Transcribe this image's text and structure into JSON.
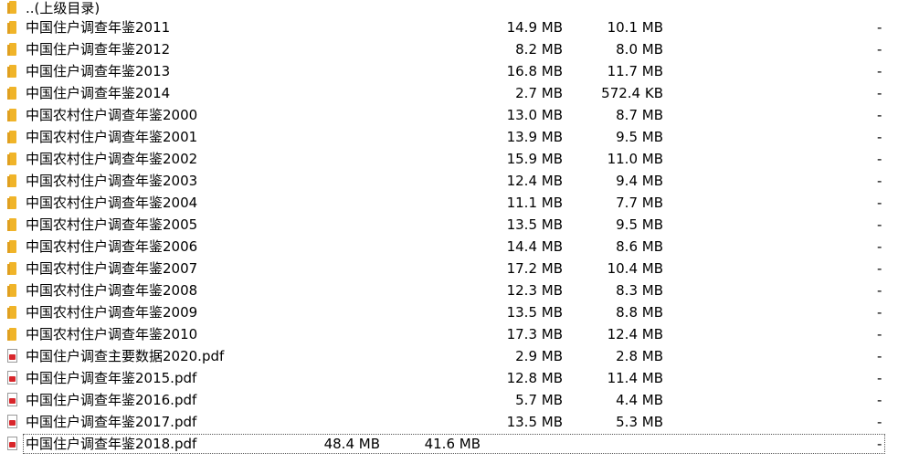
{
  "parent": {
    "name": "..(上级目录)",
    "icon": "folder-icon"
  },
  "files": [
    {
      "name": "中国住户调查年鉴2011",
      "size": "14.9 MB",
      "packed": "10.1 MB",
      "col4": "-",
      "icon": "folder-icon"
    },
    {
      "name": "中国住户调查年鉴2012",
      "size": "8.2 MB",
      "packed": "8.0 MB",
      "col4": "-",
      "icon": "folder-icon"
    },
    {
      "name": "中国住户调查年鉴2013",
      "size": "16.8 MB",
      "packed": "11.7 MB",
      "col4": "-",
      "icon": "folder-icon"
    },
    {
      "name": "中国住户调查年鉴2014",
      "size": "2.7 MB",
      "packed": "572.4 KB",
      "col4": "-",
      "icon": "folder-icon"
    },
    {
      "name": "中国农村住户调查年鉴2000",
      "size": "13.0 MB",
      "packed": "8.7 MB",
      "col4": "-",
      "icon": "folder-icon"
    },
    {
      "name": "中国农村住户调查年鉴2001",
      "size": "13.9 MB",
      "packed": "9.5 MB",
      "col4": "-",
      "icon": "folder-icon"
    },
    {
      "name": "中国农村住户调查年鉴2002",
      "size": "15.9 MB",
      "packed": "11.0 MB",
      "col4": "-",
      "icon": "folder-icon"
    },
    {
      "name": "中国农村住户调查年鉴2003",
      "size": "12.4 MB",
      "packed": "9.4 MB",
      "col4": "-",
      "icon": "folder-icon"
    },
    {
      "name": "中国农村住户调查年鉴2004",
      "size": "11.1 MB",
      "packed": "7.7 MB",
      "col4": "-",
      "icon": "folder-icon"
    },
    {
      "name": "中国农村住户调查年鉴2005",
      "size": "13.5 MB",
      "packed": "9.5 MB",
      "col4": "-",
      "icon": "folder-icon"
    },
    {
      "name": "中国农村住户调查年鉴2006",
      "size": "14.4 MB",
      "packed": "8.6 MB",
      "col4": "-",
      "icon": "folder-icon"
    },
    {
      "name": "中国农村住户调查年鉴2007",
      "size": "17.2 MB",
      "packed": "10.4 MB",
      "col4": "-",
      "icon": "folder-icon"
    },
    {
      "name": "中国农村住户调查年鉴2008",
      "size": "12.3 MB",
      "packed": "8.3 MB",
      "col4": "-",
      "icon": "folder-icon"
    },
    {
      "name": "中国农村住户调查年鉴2009",
      "size": "13.5 MB",
      "packed": "8.8 MB",
      "col4": "-",
      "icon": "folder-icon"
    },
    {
      "name": "中国农村住户调查年鉴2010",
      "size": "17.3 MB",
      "packed": "12.4 MB",
      "col4": "-",
      "icon": "folder-icon"
    },
    {
      "name": "中国住户调查主要数据2020.pdf",
      "size": "2.9 MB",
      "packed": "2.8 MB",
      "col4": "-",
      "icon": "pdf-file-icon"
    },
    {
      "name": "中国住户调查年鉴2015.pdf",
      "size": "12.8 MB",
      "packed": "11.4 MB",
      "col4": "-",
      "icon": "pdf-file-icon"
    },
    {
      "name": "中国住户调查年鉴2016.pdf",
      "size": "5.7 MB",
      "packed": "4.4 MB",
      "col4": "-",
      "icon": "pdf-file-icon"
    },
    {
      "name": "中国住户调查年鉴2017.pdf",
      "size": "13.5 MB",
      "packed": "5.3 MB",
      "col4": "-",
      "icon": "pdf-file-icon"
    },
    {
      "name": "中国住户调查年鉴2018.pdf",
      "size": "48.4 MB",
      "packed": "41.6 MB",
      "col4": "-",
      "icon": "pdf-file-icon",
      "selected": true
    }
  ],
  "colors": {
    "folder": "#f0b429",
    "pdf_accent": "#d8262b"
  }
}
